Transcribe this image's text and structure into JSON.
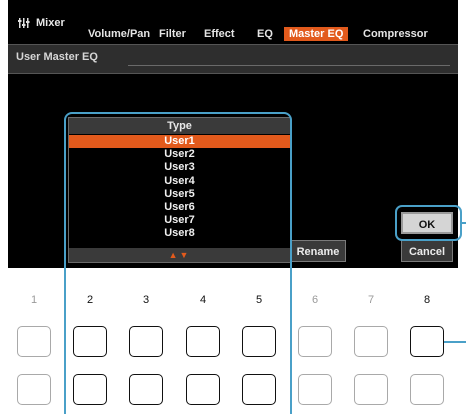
{
  "app": {
    "title": "Mixer",
    "icon": "mixer-sliders-icon"
  },
  "tabs": [
    {
      "label": "Volume/Pan",
      "active": false
    },
    {
      "label": "Filter",
      "active": false
    },
    {
      "label": "Effect",
      "active": false
    },
    {
      "label": "EQ",
      "active": false
    },
    {
      "label": "Master EQ",
      "active": true
    },
    {
      "label": "Compressor",
      "active": false
    }
  ],
  "page": {
    "title": "User Master EQ"
  },
  "type_list": {
    "header": "Type",
    "items": [
      "User1",
      "User2",
      "User3",
      "User4",
      "User5",
      "User6",
      "User7",
      "User8"
    ],
    "selected": "User1",
    "scroll_indicator": "▲▼"
  },
  "buttons": {
    "rename": "Rename",
    "ok": "OK",
    "cancel": "Cancel"
  },
  "panel": {
    "numbers": [
      "1",
      "2",
      "3",
      "4",
      "5",
      "6",
      "7",
      "8"
    ]
  },
  "colors": {
    "accent": "#e25a1c",
    "callout": "#4aa0c8",
    "screen": "#000000"
  }
}
